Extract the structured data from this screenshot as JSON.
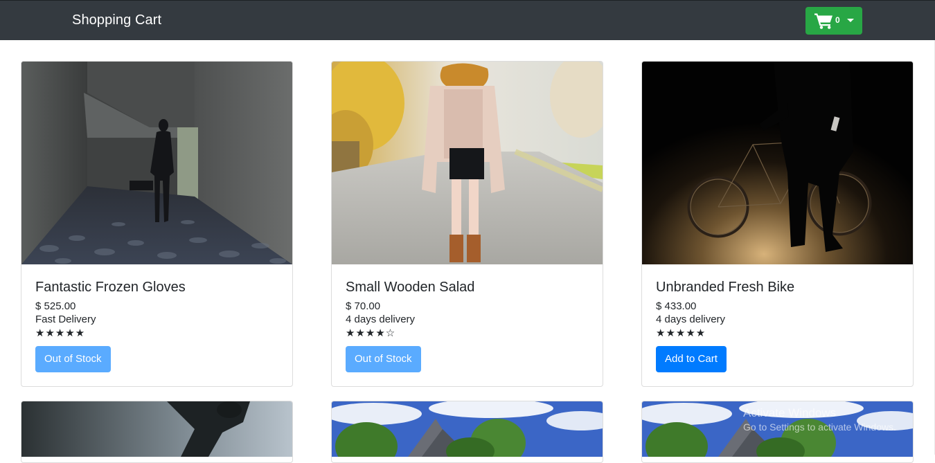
{
  "navbar": {
    "brand": "Shopping Cart",
    "cart_count": "0",
    "cart_icon": "shopping-cart-icon",
    "background": "#343a40",
    "cart_button_color": "#28a745"
  },
  "products": [
    {
      "title": "Fantastic Frozen Gloves",
      "price": "$ 525.00",
      "delivery": "Fast Delivery",
      "rating": 5,
      "rating_max": 5,
      "stars": "★★★★★",
      "button_label": "Out of Stock",
      "button_state": "disabled"
    },
    {
      "title": "Small Wooden Salad",
      "price": "$ 70.00",
      "delivery": "4 days delivery",
      "rating": 4,
      "rating_max": 5,
      "stars": "★★★★☆",
      "button_label": "Out of Stock",
      "button_state": "disabled"
    },
    {
      "title": "Unbranded Fresh Bike",
      "price": "$ 433.00",
      "delivery": "4 days delivery",
      "rating": 5,
      "rating_max": 5,
      "stars": "★★★★★",
      "button_label": "Add to Cart",
      "button_state": "enabled"
    }
  ],
  "watermark": {
    "line1": "Activate Windows",
    "line2": "Go to Settings to activate Windows."
  },
  "colors": {
    "primary_button": "#007bff",
    "disabled_button": "#5aabff"
  }
}
